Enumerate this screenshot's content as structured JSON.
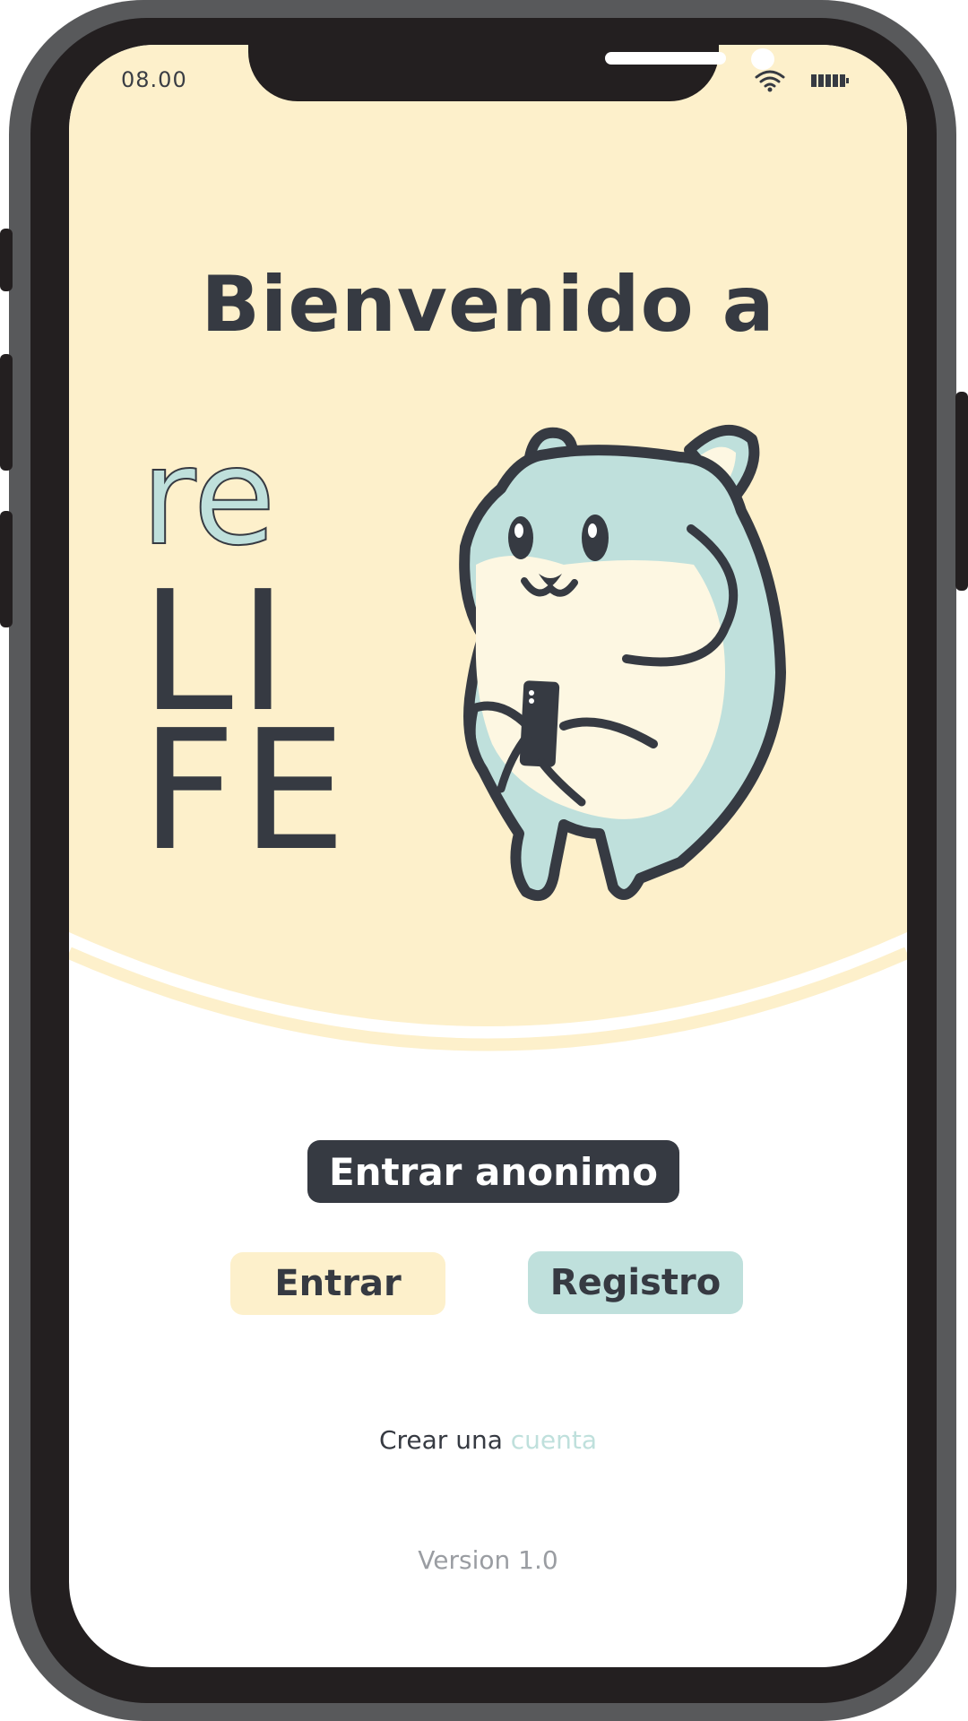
{
  "status_bar": {
    "time": "08.00",
    "icons": [
      "wifi-icon",
      "battery-icon"
    ]
  },
  "hero": {
    "title": "Bienvenido a",
    "logo": {
      "line1": "re",
      "line2": "LI",
      "line3": "FE"
    },
    "mascot": "hamster-holding-phone-illustration"
  },
  "actions": {
    "anonymous_label": "Entrar anonimo",
    "login_label": "Entrar",
    "register_label": "Registro"
  },
  "footer": {
    "create_prefix": "Crear una",
    "create_link": "cuenta",
    "version": "Version 1.0"
  },
  "colors": {
    "cream": "#fdf0cb",
    "mint": "#bfe0dc",
    "dark": "#363a42",
    "frame": "#58595b",
    "bezel": "#231f20"
  }
}
